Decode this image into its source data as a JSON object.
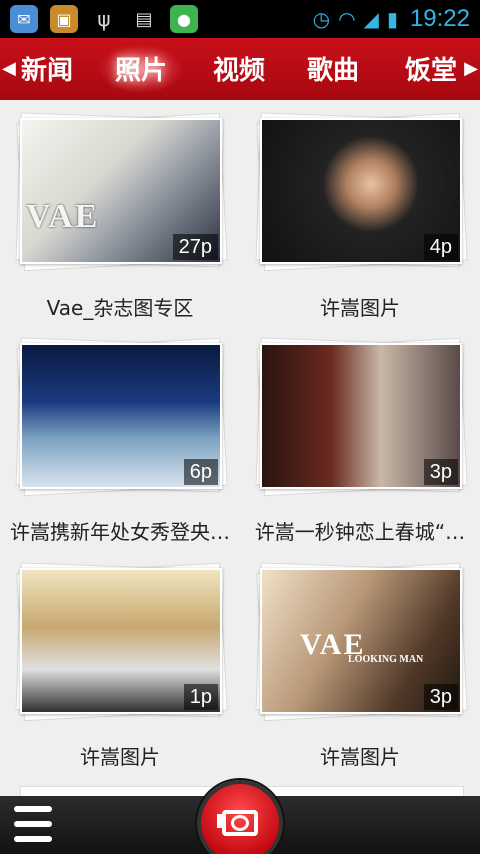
{
  "status_bar": {
    "time": "19:22",
    "icons": [
      "message-icon",
      "package-icon",
      "usb-icon",
      "android-icon",
      "wechat-icon",
      "alarm-icon",
      "wifi-icon",
      "signal-icon",
      "battery-icon"
    ]
  },
  "tabs": [
    {
      "label": "新闻",
      "active": false
    },
    {
      "label": "照片",
      "active": true
    },
    {
      "label": "视频",
      "active": false
    },
    {
      "label": "歌曲",
      "active": false
    },
    {
      "label": "饭堂",
      "active": false
    }
  ],
  "albums": [
    {
      "title": "Vae_杂志图专区",
      "count": "27p"
    },
    {
      "title": "许嵩图片",
      "count": "4p"
    },
    {
      "title": "许嵩携新年处女秀登央…",
      "count": "6p"
    },
    {
      "title": "许嵩一秒钟恋上春城“…",
      "count": "3p"
    },
    {
      "title": "许嵩图片",
      "count": "1p"
    },
    {
      "title": "许嵩图片",
      "count": "3p"
    }
  ],
  "photo_text": {
    "album1_logo": "VAE",
    "album6_logo": "VAE",
    "album6_sub": "LOOKING MAN"
  },
  "colors": {
    "accent_red": "#c8101a",
    "status_blue": "#33b5e5"
  }
}
